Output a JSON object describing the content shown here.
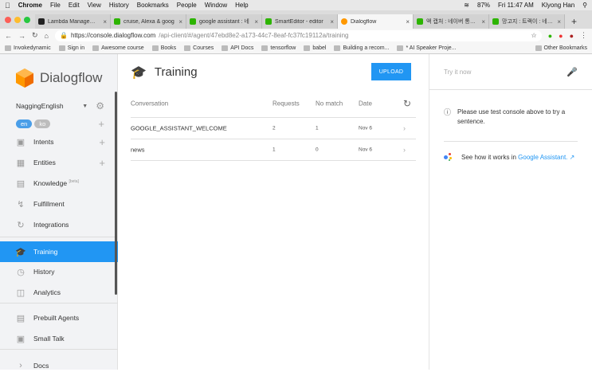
{
  "menubar": {
    "app": "Chrome",
    "menus": [
      "File",
      "Edit",
      "View",
      "History",
      "Bookmarks",
      "People",
      "Window",
      "Help"
    ],
    "battery": "87%",
    "clock": "Fri 11:47 AM",
    "user": "Klyong Han"
  },
  "tabs": [
    {
      "label": "Lambda Managemen",
      "color": "#222222"
    },
    {
      "label": "cruise, Alexa & goog",
      "color": "#2db400"
    },
    {
      "label": "google assistant : 네",
      "color": "#2db400"
    },
    {
      "label": "SmartEditor - editor",
      "color": "#2db400"
    },
    {
      "label": "Dialogflow",
      "color": "#ff9800"
    },
    {
      "label": "액 캡처 : 네이버 통합검",
      "color": "#2db400"
    },
    {
      "label": "망고지 : 트랙이 : 네이버",
      "color": "#2db400"
    }
  ],
  "address": {
    "host": "https://console.dialogflow.com",
    "path": "/api-client/#/agent/47ebd8e2-a173-44c7-8eaf-fc37fc19112a/training"
  },
  "bookmarks": [
    "Invokedynamic",
    "Sign in",
    "Awesome course",
    "Books",
    "Courses",
    "API Docs",
    "tensorflow",
    "babel",
    "Building a recom...",
    "* AI Speaker Proje..."
  ],
  "other_bookmarks": "Other Bookmarks",
  "sidebar": {
    "brand": "Dialogflow",
    "agent": "NaggingEnglish",
    "languages": [
      "en",
      "ko"
    ],
    "items": [
      {
        "label": "Intents",
        "icon": "chat-icon"
      },
      {
        "label": "Entities",
        "icon": "hierarchy-icon"
      },
      {
        "label": "Knowledge",
        "badge": "[beta]",
        "icon": "book-icon"
      },
      {
        "label": "Fulfillment",
        "icon": "bolt-icon"
      },
      {
        "label": "Integrations",
        "icon": "refresh-icon"
      },
      {
        "label": "Training",
        "icon": "graduation-cap-icon"
      },
      {
        "label": "History",
        "icon": "clock-icon"
      },
      {
        "label": "Analytics",
        "icon": "bar-chart-icon"
      },
      {
        "label": "Prebuilt Agents",
        "icon": "book-icon"
      },
      {
        "label": "Small Talk",
        "icon": "chat-icon"
      },
      {
        "label": "Docs",
        "icon": "chevron-right-icon"
      }
    ]
  },
  "main": {
    "title": "Training",
    "upload_label": "UPLOAD",
    "columns": {
      "conversation": "Conversation",
      "requests": "Requests",
      "no_match": "No match",
      "date": "Date"
    },
    "rows": [
      {
        "conversation": "GOOGLE_ASSISTANT_WELCOME",
        "requests": "2",
        "no_match": "1",
        "date": "Nov 6"
      },
      {
        "conversation": "news",
        "requests": "1",
        "no_match": "0",
        "date": "Nov 6"
      }
    ]
  },
  "console": {
    "placeholder": "Try it now",
    "info": "Please use test console above to try a sentence.",
    "ga_text": "See how it works in ",
    "ga_link": "Google Assistant."
  },
  "colors": {
    "accent": "#2196f3",
    "brand_orange": "#ff9800",
    "lang_en": "#4a9ee8",
    "lang_ko": "#bdbdbd"
  }
}
